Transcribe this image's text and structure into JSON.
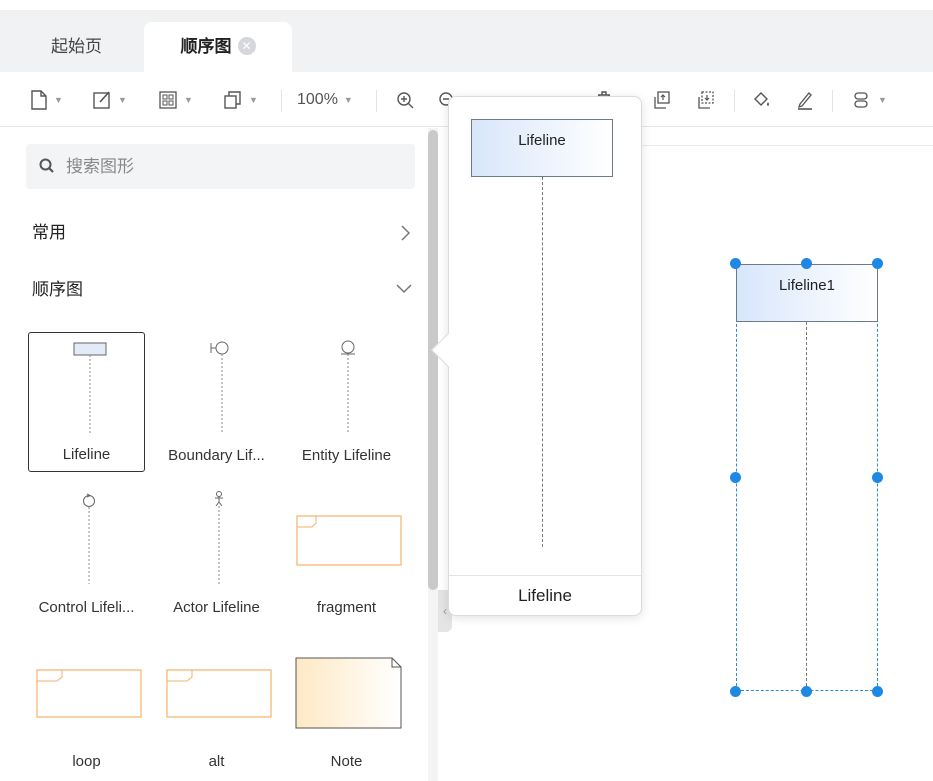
{
  "tabs": [
    {
      "label": "起始页",
      "active": false
    },
    {
      "label": "顺序图",
      "active": true,
      "closable": true
    }
  ],
  "toolbar": {
    "zoom_label": "100%",
    "icons": [
      "new-file-icon",
      "edit-icon",
      "layout-icon",
      "copy-icon",
      "zoom-in-icon",
      "zoom-out-icon",
      "undo-icon",
      "redo-icon",
      "delete-icon",
      "bring-front-icon",
      "send-back-icon",
      "fill-icon",
      "line-color-icon",
      "more-icon"
    ]
  },
  "sidebar": {
    "search_placeholder": "搜索图形",
    "sections": [
      {
        "label": "常用",
        "expanded": false
      },
      {
        "label": "顺序图",
        "expanded": true
      }
    ],
    "shapes": [
      {
        "label": "Lifeline",
        "selected": true
      },
      {
        "label": "Boundary Lif..."
      },
      {
        "label": "Entity Lifeline"
      },
      {
        "label": "Control Lifeli..."
      },
      {
        "label": "Actor Lifeline"
      },
      {
        "label": "fragment"
      },
      {
        "label": "loop"
      },
      {
        "label": "alt"
      },
      {
        "label": "Note"
      }
    ]
  },
  "popover": {
    "preview_label": "Lifeline",
    "footer_label": "Lifeline"
  },
  "canvas": {
    "lifeline_label": "Lifeline1"
  },
  "colors": {
    "accent": "#1e88e5",
    "fragment_border": "#f5b26b",
    "lifeline_fill_start": "#d8e6fb"
  }
}
